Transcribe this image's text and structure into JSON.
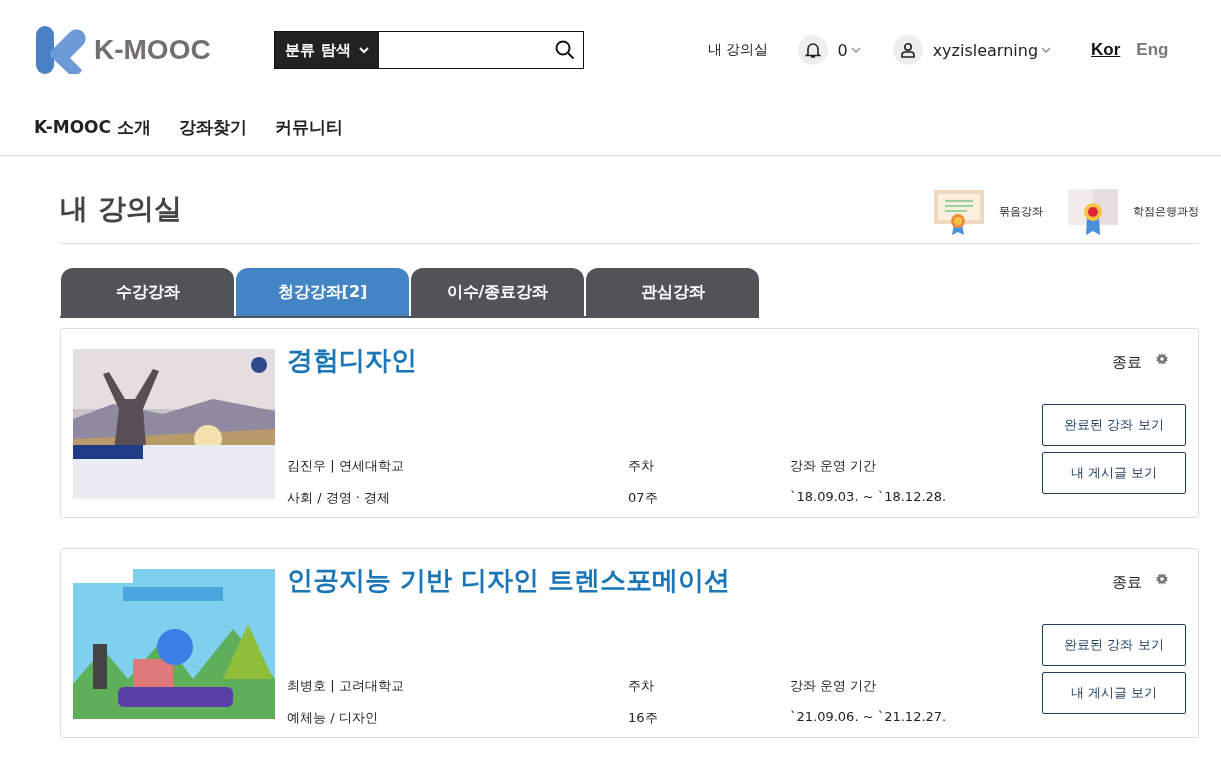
{
  "header": {
    "logo": "K-MOOC",
    "category_button": "분류 탐색",
    "my_classroom_link": "내 강의실",
    "notification_count": "0",
    "username": "xyzislearning",
    "languages": [
      {
        "label": "Kor",
        "selected": true
      },
      {
        "label": "Eng",
        "selected": false
      }
    ]
  },
  "nav": [
    "K-MOOC 소개",
    "강좌찾기",
    "커뮤니티"
  ],
  "page": {
    "title": "내 강의실",
    "shortcuts": [
      {
        "label": "묶음강좌",
        "kind": "certificate"
      },
      {
        "label": "학점은행과정",
        "kind": "medal"
      }
    ]
  },
  "tabs": [
    {
      "label": "수강강좌",
      "selected": false
    },
    {
      "label": "청강강좌[2]",
      "selected": true
    },
    {
      "label": "이수/종료강좌",
      "selected": false
    },
    {
      "label": "관심강좌",
      "selected": false
    }
  ],
  "courses": [
    {
      "thumbnail": {
        "kind": "picture"
      },
      "title": "경험디자인",
      "status": "종료",
      "instructor": "김진우 | 연세대학교",
      "category": "사회 / 경영 · 경제",
      "weeks_label": "주차",
      "weeks": "07주",
      "period_label": "강좌 운영 기간",
      "period": "`18.09.03. ~ `18.12.28.",
      "buttons": [
        "완료된 강좌 보기",
        "내 게시글 보기"
      ]
    },
    {
      "thumbnail": {
        "kind": "picture"
      },
      "title": "인공지능 기반 디자인 트렌스포메이션",
      "status": "종료",
      "instructor": "최병호 | 고려대학교",
      "category": "예체능 / 디자인",
      "weeks_label": "주차",
      "weeks": "16주",
      "period_label": "강좌 운영 기간",
      "period": "`21.09.06. ~ `21.12.27.",
      "buttons": [
        "완료된 강좌 보기",
        "내 게시글 보기"
      ]
    }
  ]
}
